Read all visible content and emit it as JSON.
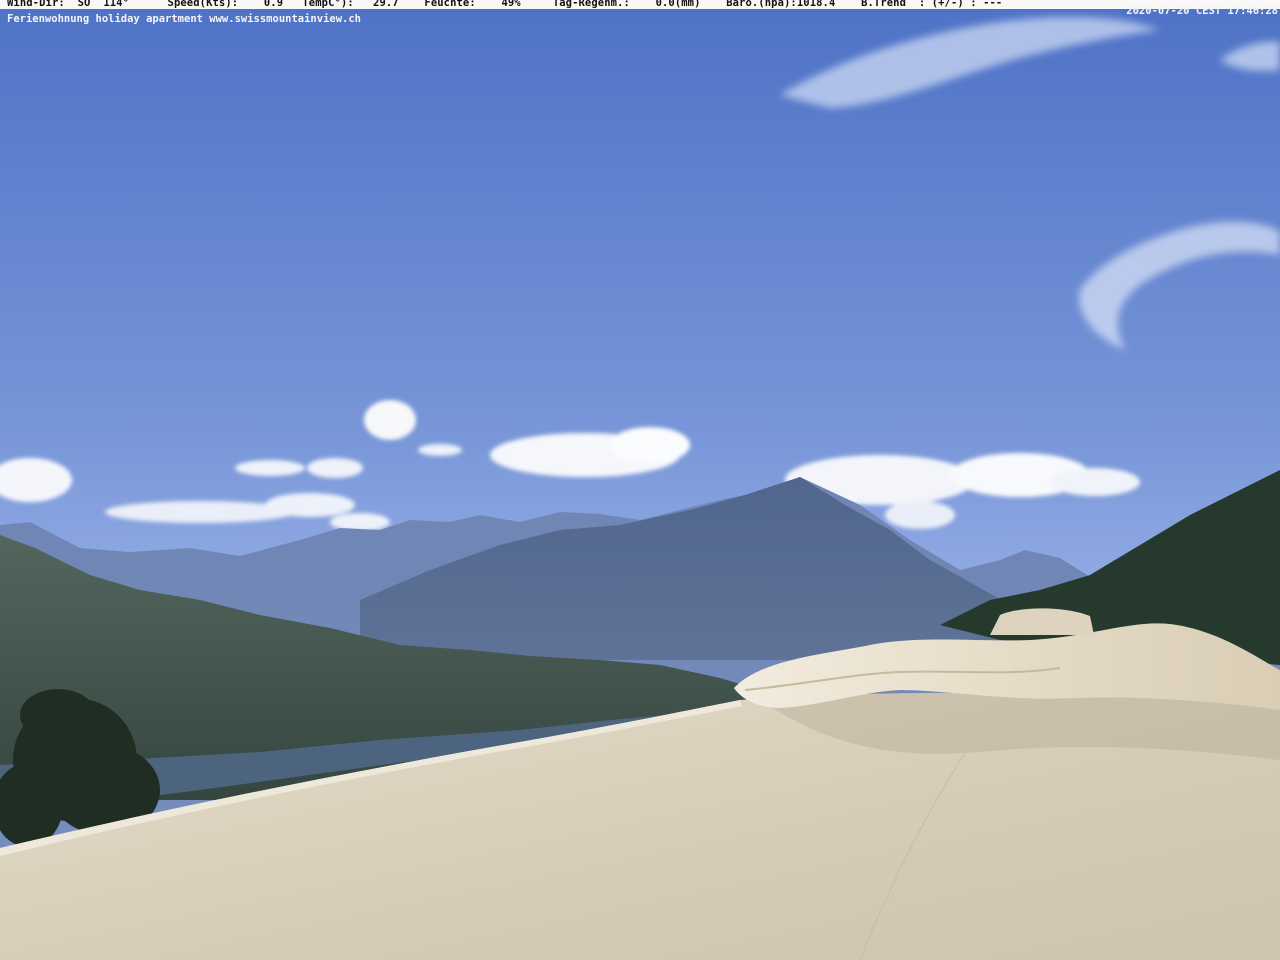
{
  "overlay": {
    "weather_line": "Wind-Dir:  SO  114°      Speed(Kts):    0.9   TempC°):   29.7    Feuchte:    49%     Tag-Regenm.:    0.0(mm)    Baro.(hpa):1018.4    B.Trend  : (+/-) : ---",
    "timestamp": "2020-07-20 CEST 17:46:28",
    "caption": "Ferienwohnung holiday apartment www.swissmountainview.ch"
  },
  "scene": {
    "description_items": [
      "sky",
      "clouds",
      "alpine-mountains",
      "lake-valley",
      "tree",
      "canvas-awning"
    ]
  },
  "colors": {
    "sky_top": "#4f73c8",
    "sky_mid": "#7d9ddd",
    "sky_low": "#b2c7ef",
    "mountain_far": "#6f86b6",
    "mountain_mid": "#54698f",
    "valley": "#4f6258",
    "foreground": "#d8d1bf"
  }
}
